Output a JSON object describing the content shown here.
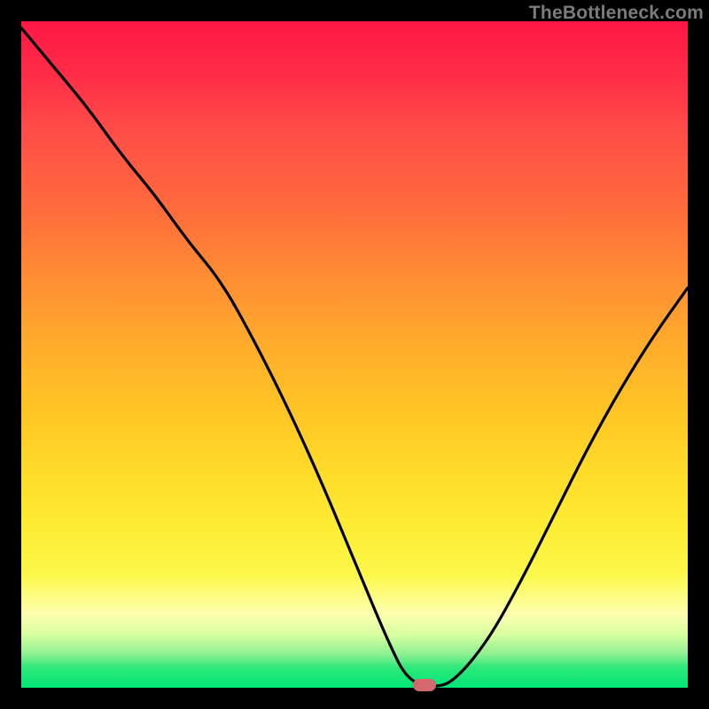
{
  "watermark": {
    "text": "TheBottleneck.com"
  },
  "chart_data": {
    "type": "line",
    "title": "",
    "xlabel": "",
    "ylabel": "",
    "xlim": [
      0,
      100
    ],
    "ylim": [
      0,
      100
    ],
    "x": [
      0,
      5,
      10,
      15,
      20,
      25,
      30,
      35,
      40,
      45,
      50,
      55,
      58,
      62,
      65,
      70,
      75,
      80,
      85,
      90,
      95,
      100
    ],
    "values": [
      99,
      93,
      87,
      80,
      74,
      67,
      61,
      52,
      42,
      31,
      19,
      7,
      1,
      0,
      1,
      7,
      16,
      26,
      36,
      45,
      53,
      60
    ],
    "marker": {
      "x": 60.5,
      "y": 0,
      "color": "#d5686f"
    },
    "colors": {
      "background_top": "#ff1744",
      "background_bottom": "#00e676",
      "curve": "#000000",
      "frame": "#000000"
    }
  }
}
